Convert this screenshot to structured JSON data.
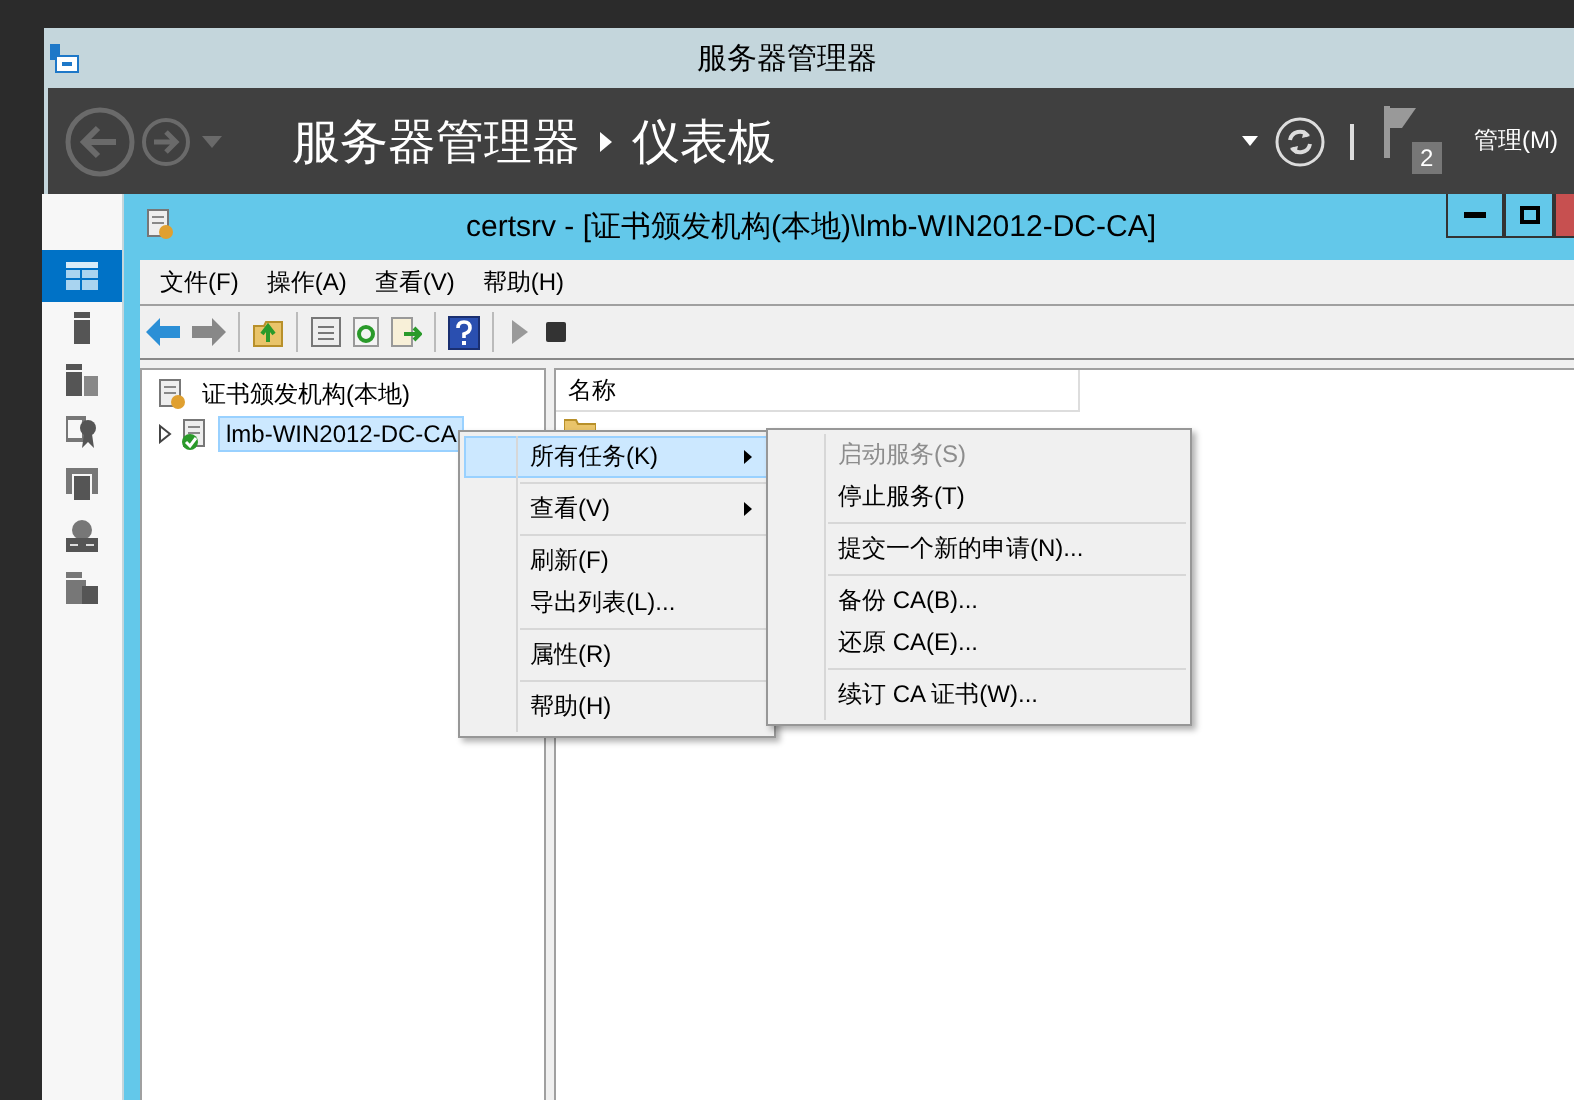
{
  "server_manager": {
    "title": "服务器管理器",
    "breadcrumb": [
      "服务器管理器",
      "仪表板"
    ],
    "manage_menu": "管理(M)",
    "notification_count": "2",
    "sidebar_items": [
      {
        "kind": "dashboard",
        "selected": true
      },
      {
        "kind": "server",
        "selected": false
      },
      {
        "kind": "servers",
        "selected": false
      },
      {
        "kind": "certificate",
        "selected": false
      },
      {
        "kind": "files",
        "selected": false
      },
      {
        "kind": "network",
        "selected": false
      },
      {
        "kind": "storage",
        "selected": false
      }
    ]
  },
  "mmc": {
    "title": "certsrv - [证书颁发机构(本地)\\lmb-WIN2012-DC-CA]",
    "menu": [
      "文件(F)",
      "操作(A)",
      "查看(V)",
      "帮助(H)"
    ],
    "tree": [
      {
        "label": "证书颁发机构(本地)",
        "children": [
          {
            "label": "lmb-WIN2012-DC-CA",
            "selected": true,
            "expanded": false
          }
        ]
      }
    ],
    "list": {
      "columns": [
        "名称"
      ]
    }
  },
  "context_menu": {
    "groups": [
      [
        {
          "label": "所有任务(K)",
          "submenu": true,
          "selected": true
        }
      ],
      [
        {
          "label": "查看(V)",
          "submenu": true,
          "selected": false
        }
      ],
      [
        {
          "label": "刷新(F)",
          "submenu": false,
          "selected": false
        },
        {
          "label": "导出列表(L)...",
          "submenu": false,
          "selected": false
        }
      ],
      [
        {
          "label": "属性(R)",
          "submenu": false,
          "selected": false
        }
      ],
      [
        {
          "label": "帮助(H)",
          "submenu": false,
          "selected": false
        }
      ]
    ]
  },
  "submenu": {
    "groups": [
      [
        {
          "label": "启动服务(S)",
          "disabled": true
        },
        {
          "label": "停止服务(T)",
          "disabled": false
        }
      ],
      [
        {
          "label": "提交一个新的申请(N)...",
          "disabled": false
        }
      ],
      [
        {
          "label": "备份 CA(B)...",
          "disabled": false
        },
        {
          "label": "还原 CA(E)...",
          "disabled": false
        }
      ],
      [
        {
          "label": "续订 CA 证书(W)...",
          "disabled": false
        }
      ]
    ]
  }
}
